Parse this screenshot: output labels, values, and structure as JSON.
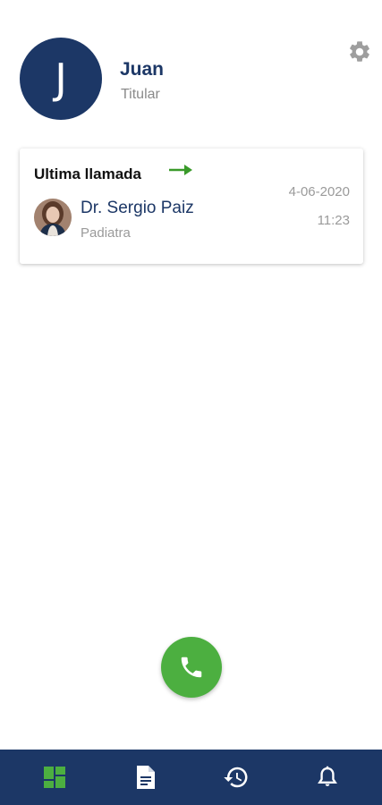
{
  "user": {
    "initial": "J",
    "name": "Juan",
    "role": "Titular"
  },
  "last_call": {
    "title": "Ultima llamada",
    "doctor_name": "Dr. Sergio Paiz",
    "specialty": "Padiatra",
    "date": "4-06-2020",
    "time": "11:23"
  },
  "colors": {
    "primary": "#1c3766",
    "accent_green": "#4caf40",
    "muted_text": "#9a9a9a"
  },
  "nav": {
    "items": [
      {
        "icon": "dashboard-icon",
        "active": true
      },
      {
        "icon": "document-icon",
        "active": false
      },
      {
        "icon": "history-icon",
        "active": false
      },
      {
        "icon": "bell-icon",
        "active": false
      }
    ]
  }
}
